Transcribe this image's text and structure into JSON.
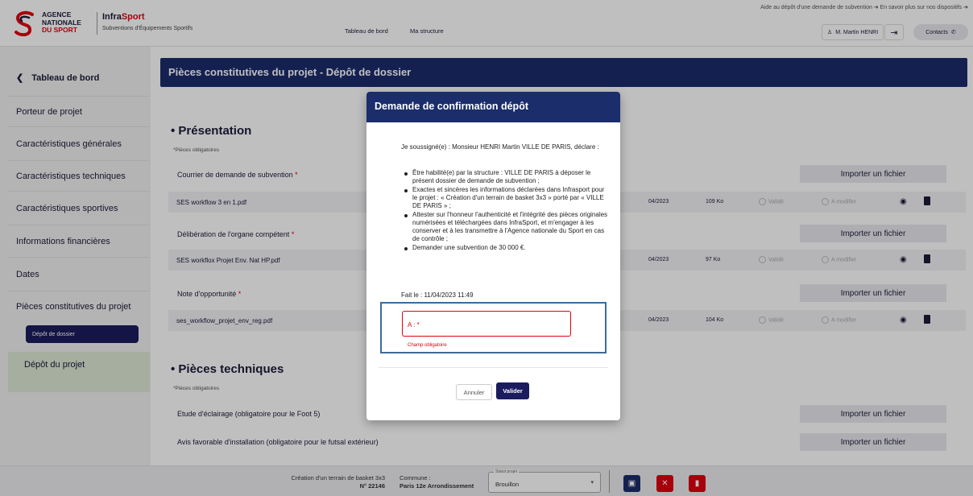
{
  "header": {
    "logo_lines": [
      "AGENCE",
      "NATIONALE",
      "DU SPORT"
    ],
    "brand": "InfraSport",
    "brand_prefix": "Infra",
    "brand_suffix": "Sport",
    "subtitle": "Subventions d'Équipements Sportifs",
    "nav": [
      "Tableau de bord",
      "Ma structure"
    ],
    "toplinks": [
      "Aide au dépôt d'une demande de subvention",
      "En savoir plus sur nos dispositifs"
    ],
    "user": "M. Martin HENRI",
    "contacts": "Contacts"
  },
  "sidebar": {
    "back": "Tableau de bord",
    "items": [
      "Porteur de projet",
      "Caractéristiques générales",
      "Caractéristiques techniques",
      "Caractéristiques sportives",
      "Informations financières",
      "Dates",
      "Pièces constitutives du projet"
    ],
    "sub_button": "Dépôt de dossier",
    "active": "Dépôt du projet"
  },
  "main": {
    "banner": "Pièces constitutives du projet - Dépôt de dossier",
    "sections": [
      {
        "title": "Présentation",
        "required_note": "*Pièces obligatoires"
      },
      {
        "title": "Pièces techniques",
        "required_note": "*Pièces obligatoires"
      }
    ],
    "documents": [
      {
        "label": "Courrier de demande de subvention",
        "file": "SES workflow 3 en 1.pdf",
        "date": "04/2023",
        "size": "109 Ko"
      },
      {
        "label": "Délibération de l'organe compétent",
        "file": "SES workflox Projet Env. Nat HP.pdf",
        "date": "04/2023",
        "size": "97 Ko"
      },
      {
        "label": "Note d'opportunité",
        "file": "ses_workflow_projet_env_reg.pdf",
        "date": "04/2023",
        "size": "104 Ko"
      }
    ],
    "tech_rows": [
      "Etude d'éclairage (obligatoire pour le Foot 5)",
      "Avis favorable d'installation (obligatoire pour le futsal extérieur)"
    ],
    "import_label": "Importer un fichier",
    "valid_label": "Validé",
    "modify_label": "A modifier"
  },
  "modal": {
    "title": "Demande de confirmation dépôt",
    "intro": "Je soussigné(e) : Monsieur HENRI Martin VILLE DE PARIS, déclare :",
    "items": [
      "Être habilité(e) par la structure : VILLE DE PARIS à déposer le présent dossier de demande de subvention ;",
      "Exactes et sincères les informations déclarées dans Infrasport pour le projet : « Création d'un terrain de basket 3x3 » porté par « VILLE DE PARIS » ;",
      "Attester sur l'honneur l'authenticité et l'intégrité des pièces originales numérisées et téléchargées dans InfraSport, et m'engager à les conserver et à les transmettre à l'Agence nationale du Sport en cas de contrôle ;",
      "Demander une subvention de 30 000 €."
    ],
    "date": "Fait le : 11/04/2023 11:49",
    "field_label": "A : *",
    "field_error": "Champ obligatoire",
    "cancel": "Annuler",
    "validate": "Valider"
  },
  "footer": {
    "project_name": "Création d'un terrain de basket 3x3",
    "project_number": "N° 22146",
    "commune_label": "Commune :",
    "commune_value": "Paris 12e Arrondissement",
    "status_label": "Statut projet",
    "status_value": "Brouillon"
  },
  "colors": {
    "navy": "#1b2d6b",
    "red": "#e1000f",
    "active_bg": "#dde8d5"
  }
}
